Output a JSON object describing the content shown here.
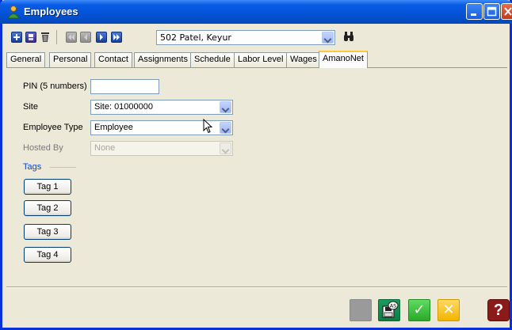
{
  "window": {
    "title": "Employees",
    "icon": "employees-app-icon",
    "controls": [
      "minimize",
      "maximize",
      "close"
    ]
  },
  "toolbar": {
    "buttons": [
      {
        "icon": "add-icon"
      },
      {
        "icon": "save-record-icon"
      },
      {
        "icon": "delete-icon"
      },
      {
        "icon": "first-record-icon"
      },
      {
        "icon": "previous-record-icon"
      },
      {
        "icon": "next-record-icon"
      },
      {
        "icon": "last-record-icon"
      },
      {
        "icon": "binoculars-search-icon"
      }
    ],
    "employee_selected": "502 Patel, Keyur"
  },
  "tabs": [
    {
      "label": "General",
      "active": false
    },
    {
      "label": "Personal",
      "active": false
    },
    {
      "label": "Contact",
      "active": false
    },
    {
      "label": "Assignments",
      "active": false
    },
    {
      "label": "Schedule",
      "active": false
    },
    {
      "label": "Labor Level",
      "active": false
    },
    {
      "label": "Wages",
      "active": false
    },
    {
      "label": "AmanoNet",
      "active": true
    }
  ],
  "form": {
    "pin_label": "PIN (5 numbers)",
    "pin_value": "",
    "site_label": "Site",
    "site_value": "Site: 01000000",
    "employee_type_label": "Employee Type",
    "employee_type_value": "Employee",
    "hosted_by_label": "Hosted By",
    "hosted_by_value": "None",
    "tags_title": "Tags",
    "tags": [
      "Tag 1",
      "Tag 2",
      "Tag 3",
      "Tag 4"
    ]
  },
  "footer": {
    "buttons": [
      {
        "icon": "disabled-blank-icon"
      },
      {
        "icon": "save-as-icon",
        "badge": "AS"
      },
      {
        "icon": "ok-check-icon",
        "glyph": "✓"
      },
      {
        "icon": "cancel-x-icon",
        "glyph": "✕"
      },
      {
        "icon": "help-icon",
        "glyph": "?"
      }
    ]
  },
  "colors": {
    "titlebar": "#0353d6",
    "panel": "#ece9d8",
    "active_tab_accent": "#ffc83c",
    "tags_title": "#0046d5"
  }
}
